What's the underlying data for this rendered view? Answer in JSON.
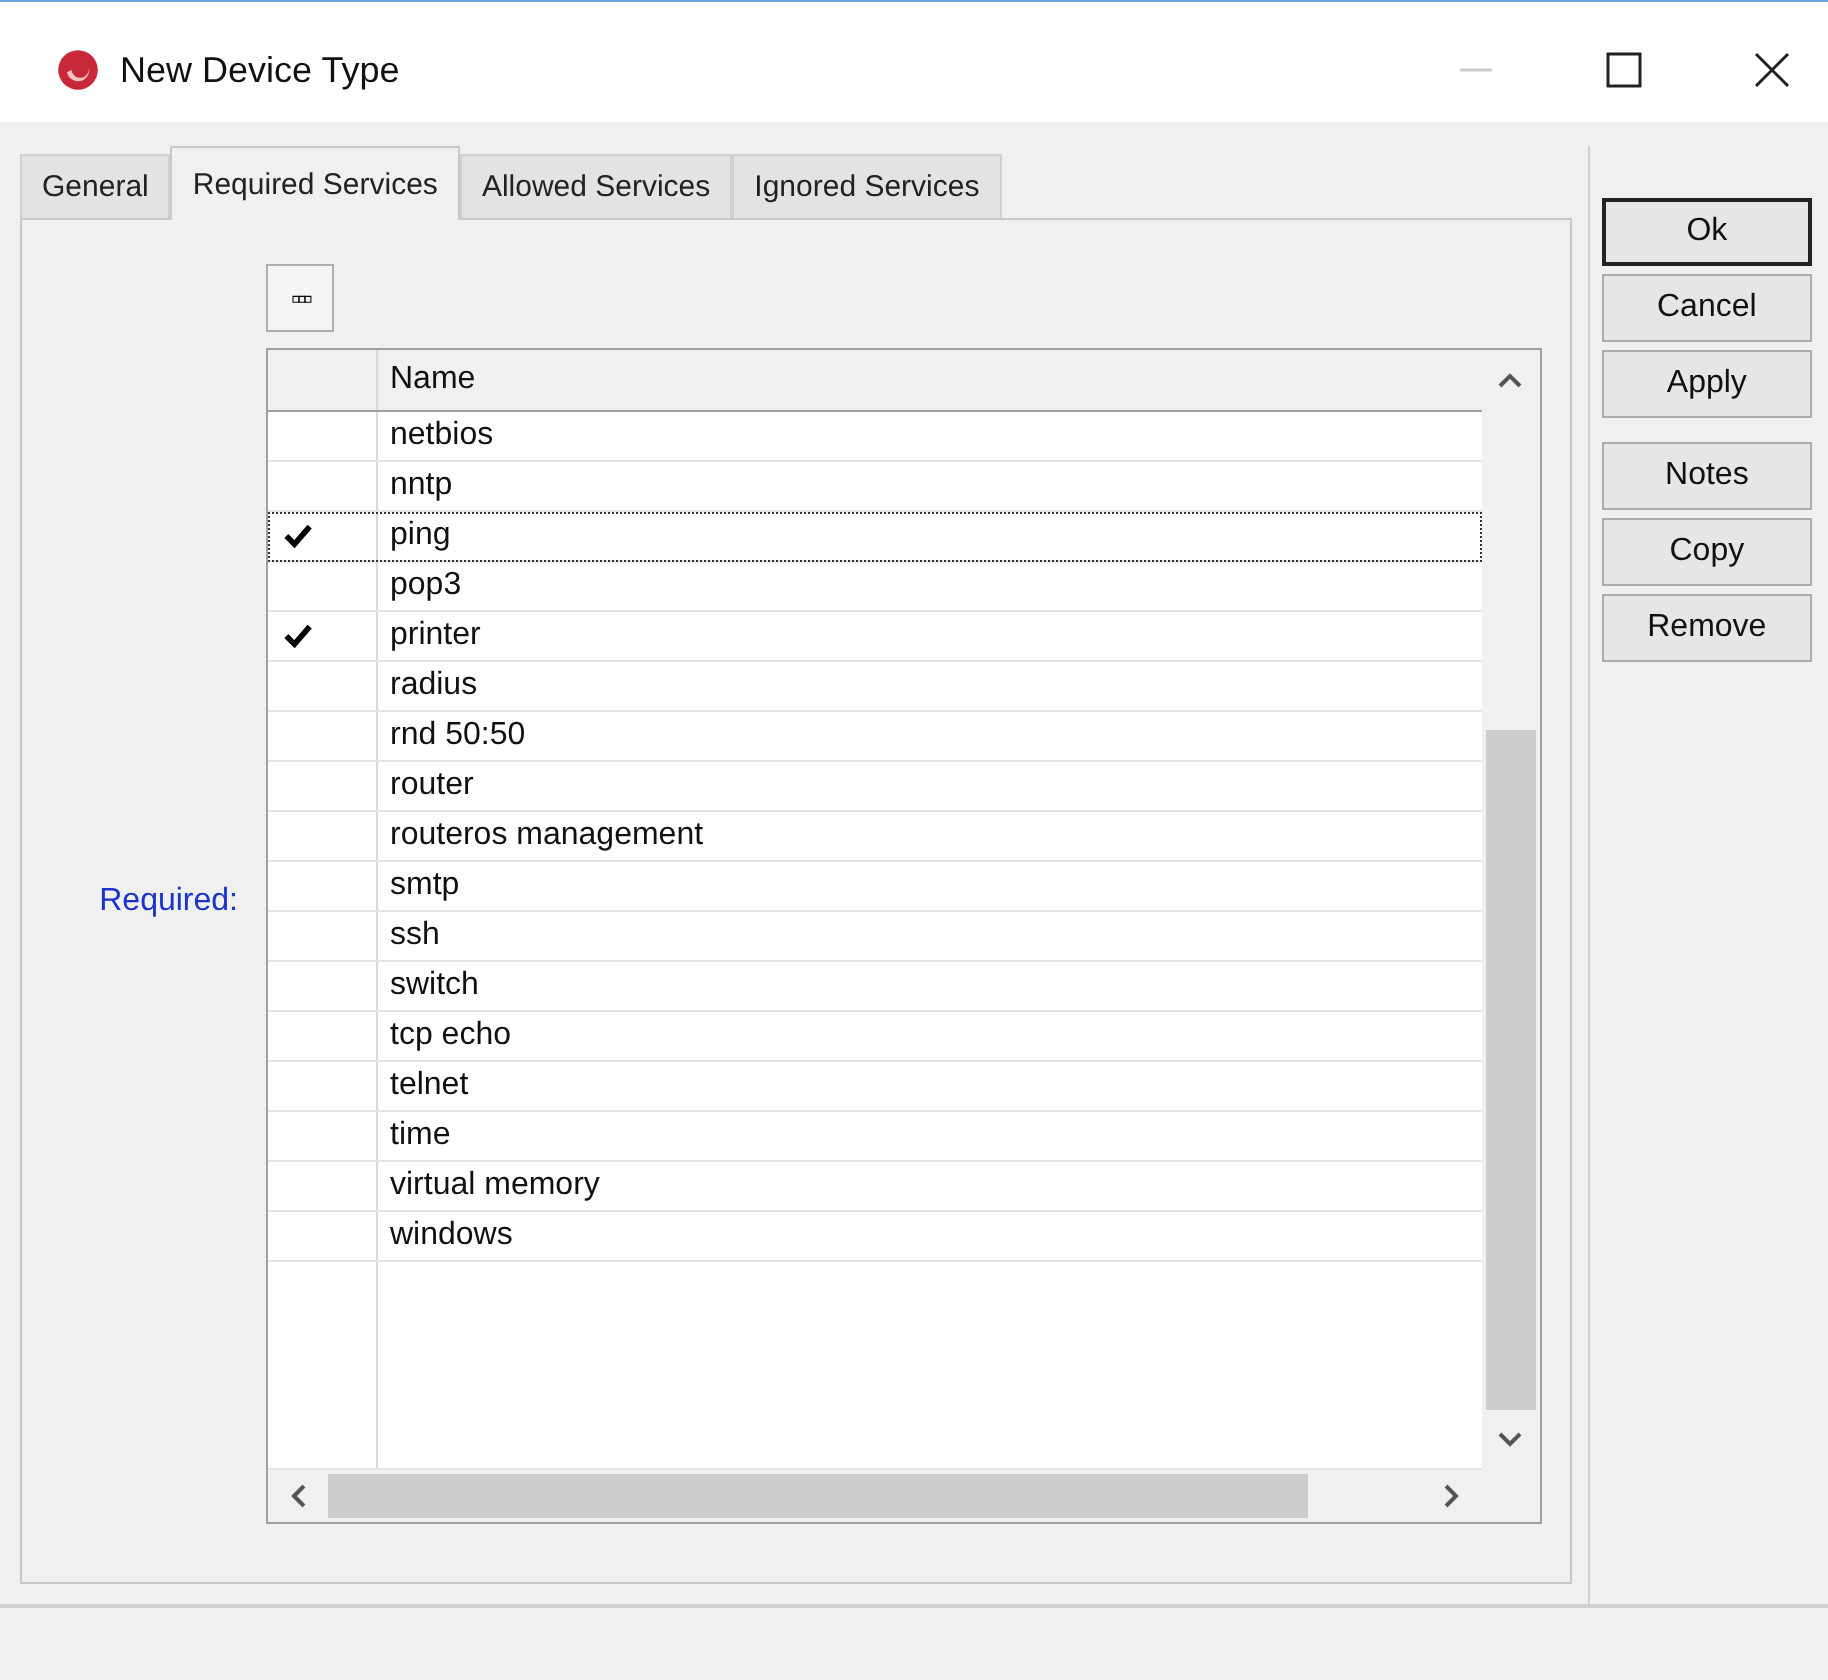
{
  "window": {
    "title": "New Device Type"
  },
  "tabs": [
    {
      "label": "General",
      "selected": false
    },
    {
      "label": "Required Services",
      "selected": true
    },
    {
      "label": "Allowed Services",
      "selected": false
    },
    {
      "label": "Ignored Services",
      "selected": false
    }
  ],
  "field_label": "Required:",
  "toolbar_button": "▫▫▫",
  "table": {
    "columns": [
      "Name"
    ],
    "rows": [
      {
        "name": "netbios",
        "checked": false,
        "focused": false
      },
      {
        "name": "nntp",
        "checked": false,
        "focused": false
      },
      {
        "name": "ping",
        "checked": true,
        "focused": true
      },
      {
        "name": "pop3",
        "checked": false,
        "focused": false
      },
      {
        "name": "printer",
        "checked": true,
        "focused": false
      },
      {
        "name": "radius",
        "checked": false,
        "focused": false
      },
      {
        "name": "rnd 50:50",
        "checked": false,
        "focused": false
      },
      {
        "name": "router",
        "checked": false,
        "focused": false
      },
      {
        "name": "routeros management",
        "checked": false,
        "focused": false
      },
      {
        "name": "smtp",
        "checked": false,
        "focused": false
      },
      {
        "name": "ssh",
        "checked": false,
        "focused": false
      },
      {
        "name": "switch",
        "checked": false,
        "focused": false
      },
      {
        "name": "tcp echo",
        "checked": false,
        "focused": false
      },
      {
        "name": "telnet",
        "checked": false,
        "focused": false
      },
      {
        "name": "time",
        "checked": false,
        "focused": false
      },
      {
        "name": "virtual memory",
        "checked": false,
        "focused": false
      },
      {
        "name": "windows",
        "checked": false,
        "focused": false
      }
    ]
  },
  "button_groups": [
    [
      {
        "label": "Ok",
        "default": true
      },
      {
        "label": "Cancel",
        "default": false
      },
      {
        "label": "Apply",
        "default": false
      }
    ],
    [
      {
        "label": "Notes",
        "default": false
      },
      {
        "label": "Copy",
        "default": false
      },
      {
        "label": "Remove",
        "default": false
      }
    ]
  ]
}
